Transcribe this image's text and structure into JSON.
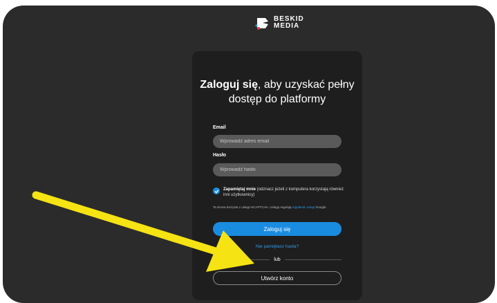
{
  "brand": {
    "line1": "BESKID",
    "line2": "MEDIA",
    "logo_icon": "beskid-media-logo"
  },
  "login": {
    "heading_bold": "Zaloguj się",
    "heading_rest": ", aby uzyskać pełny dostęp do platformy",
    "email_label": "Email",
    "email_placeholder": "Wprowadź adres email",
    "password_label": "Hasło",
    "password_placeholder": "Wprowadź hasło",
    "remember_bold": "Zapamiętaj mnie",
    "remember_rest": " (odznacz jeżeli z komputera korzystają również inni użytkownicy)",
    "recaptcha_text": "Ta strona korzysta z usługi reCAPTCHA. Usługę regulują ",
    "recaptcha_link": "regulamin usługi",
    "recaptcha_suffix": " Google.",
    "login_button": "Zaloguj się",
    "forgot_link": "Nie pamiętasz hasła?",
    "or_text": "lub",
    "create_button": "Utwórz konto"
  },
  "colors": {
    "accent": "#1a8ce0",
    "annotation_arrow": "#f5e313",
    "card": "#1e1e1e",
    "background": "#2b2b2b"
  }
}
